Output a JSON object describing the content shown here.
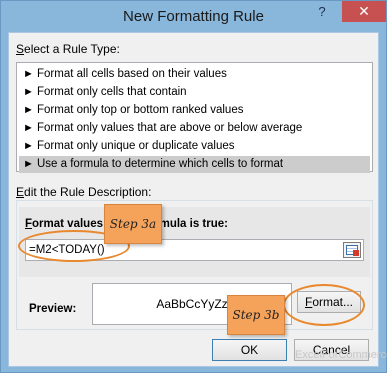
{
  "window": {
    "title": "New Formatting Rule",
    "help_label": "?",
    "close_label": "✕"
  },
  "rule_type": {
    "heading_prefix": "",
    "heading_underlined": "S",
    "heading_rest": "elect a Rule Type:",
    "arrow": "►",
    "items": [
      {
        "label": "Format all cells based on their values"
      },
      {
        "label": "Format only cells that contain"
      },
      {
        "label": "Format only top or bottom ranked values"
      },
      {
        "label": "Format only values that are above or below average"
      },
      {
        "label": "Format only unique or duplicate values"
      },
      {
        "label": "Use a formula to determine which cells to format"
      }
    ],
    "selected_index": 5
  },
  "description": {
    "heading_prefix": "",
    "heading_underlined": "E",
    "heading_rest": "dit the Rule Description:",
    "formula_label_underlined": "F",
    "formula_label_a": "ormat values w",
    "formula_label_b": "rmula is true:",
    "formula_value": "=M2<TODAY()",
    "preview_label": "Preview:",
    "preview_sample": "AaBbCcYyZz",
    "format_button_underlined": "F",
    "format_button_rest": "ormat..."
  },
  "buttons": {
    "ok": "OK",
    "cancel": "Cancel"
  },
  "annotations": {
    "step_a": "Step 3a",
    "step_b": "Step 3b",
    "accent_color": "#f5a35b",
    "ring_color": "#e8892f"
  },
  "watermark": "ExcelForCommerce"
}
